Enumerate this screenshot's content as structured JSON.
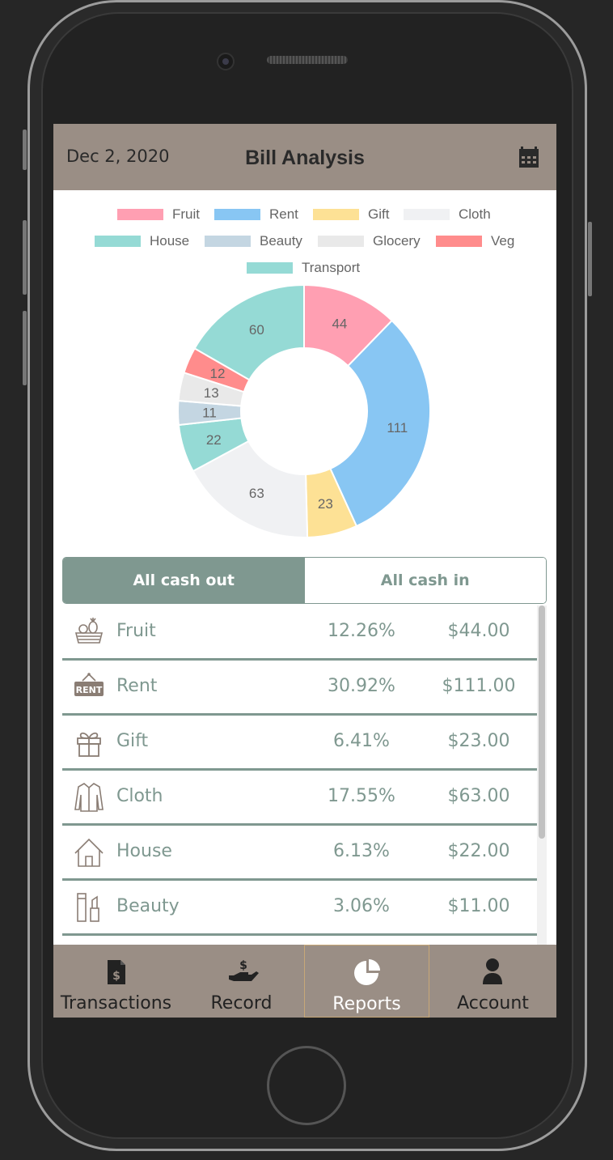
{
  "header": {
    "date": "Dec 2, 2020",
    "title": "Bill Analysis",
    "calendar_icon": "calendar-icon"
  },
  "colors": {
    "header_bg": "#9a8e85",
    "accent": "#7f9890"
  },
  "chart_data": {
    "type": "pie",
    "title": "",
    "categories": [
      "Fruit",
      "Rent",
      "Gift",
      "Cloth",
      "House",
      "Beauty",
      "Glocery",
      "Veg",
      "Transport"
    ],
    "values": [
      44,
      111,
      23,
      63,
      22,
      11,
      13,
      12,
      60
    ],
    "colors": [
      "#ff9fb2",
      "#88c6f3",
      "#fde195",
      "#f0f1f3",
      "#95dad5",
      "#c4d6e2",
      "#e9e9e9",
      "#ff8c8c",
      "#95dad5"
    ],
    "legend_position": "top"
  },
  "tabs": {
    "cash_out": "All cash out",
    "cash_in": "All cash in"
  },
  "rows": [
    {
      "name": "Fruit",
      "percent": "12.26%",
      "amount": "$44.00",
      "icon": "fruit-basket-icon"
    },
    {
      "name": "Rent",
      "percent": "30.92%",
      "amount": "$111.00",
      "icon": "rent-sign-icon"
    },
    {
      "name": "Gift",
      "percent": "6.41%",
      "amount": "$23.00",
      "icon": "gift-icon"
    },
    {
      "name": "Cloth",
      "percent": "17.55%",
      "amount": "$63.00",
      "icon": "shirt-icon"
    },
    {
      "name": "House",
      "percent": "6.13%",
      "amount": "$22.00",
      "icon": "house-icon"
    },
    {
      "name": "Beauty",
      "percent": "3.06%",
      "amount": "$11.00",
      "icon": "cosmetics-icon"
    }
  ],
  "rent_badge": "RENT",
  "nav": [
    {
      "label": "Transactions",
      "icon": "receipt-icon"
    },
    {
      "label": "Record",
      "icon": "hand-money-icon"
    },
    {
      "label": "Reports",
      "icon": "pie-chart-icon"
    },
    {
      "label": "Account",
      "icon": "user-icon"
    }
  ]
}
